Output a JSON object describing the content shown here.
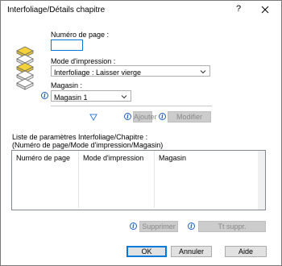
{
  "window": {
    "title": "Interfoliage/Détails chapitre",
    "help_glyph": "?",
    "close_glyph": "×"
  },
  "form": {
    "page_number_label": "Numéro de page :",
    "page_number_value": "",
    "print_mode_label": "Mode d'impression :",
    "print_mode_value": "Interfoliage : Laisser vierge",
    "tray_label": "Magasin :",
    "tray_value": "Magasin 1",
    "add_label": "Ajouter",
    "modify_label": "Modifier"
  },
  "list": {
    "title_line1": "Liste de paramètres Interfoliage/Chapitre :",
    "title_line2": "(Numéro de page/Mode d'impression/Magasin)",
    "columns": [
      "Numéro de page",
      "Mode d'impression",
      "Magasin"
    ],
    "delete_label": "Supprimer",
    "delete_all_label": "Tt suppr."
  },
  "footer": {
    "ok_label": "OK",
    "cancel_label": "Annuler",
    "help_label": "Aide"
  },
  "colors": {
    "accent": "#0078d7",
    "info_icon": "#1f5fbf",
    "stack_yellow": "#f5d23a"
  }
}
